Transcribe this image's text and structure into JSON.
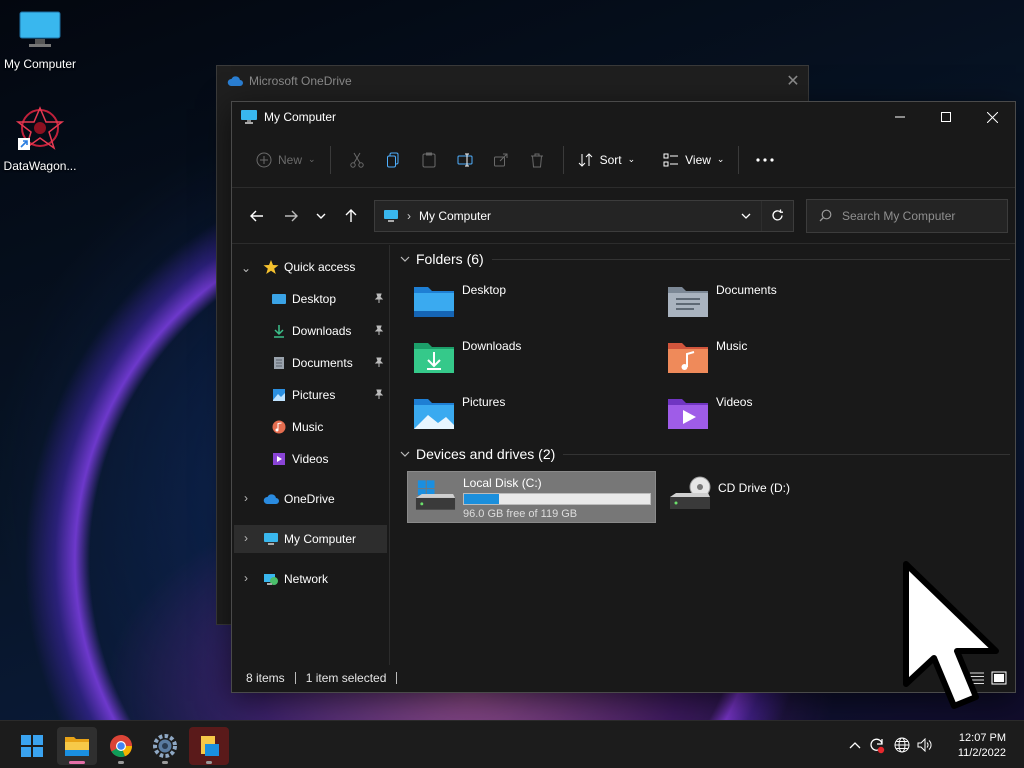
{
  "desktop": {
    "icons": [
      {
        "label": "My Computer"
      },
      {
        "label": "DataWagon..."
      }
    ]
  },
  "back_window": {
    "title": "Microsoft OneDrive"
  },
  "window": {
    "title": "My Computer",
    "toolbar": {
      "new_label": "New",
      "sort_label": "Sort",
      "view_label": "View"
    },
    "address": {
      "path": "My Computer"
    },
    "search": {
      "placeholder": "Search My Computer"
    },
    "nav": {
      "quick_access": "Quick access",
      "items": [
        {
          "label": "Desktop"
        },
        {
          "label": "Downloads"
        },
        {
          "label": "Documents"
        },
        {
          "label": "Pictures"
        },
        {
          "label": "Music"
        },
        {
          "label": "Videos"
        }
      ],
      "onedrive": "OneDrive",
      "my_computer": "My Computer",
      "network": "Network"
    },
    "folders_header": "Folders (6)",
    "folders": [
      {
        "label": "Desktop"
      },
      {
        "label": "Documents"
      },
      {
        "label": "Downloads"
      },
      {
        "label": "Music"
      },
      {
        "label": "Pictures"
      },
      {
        "label": "Videos"
      }
    ],
    "drives_header": "Devices and drives (2)",
    "drives": [
      {
        "label": "Local Disk (C:)",
        "free_text": "96.0 GB free of 119 GB",
        "used_fraction": 0.19
      },
      {
        "label": "CD Drive (D:)"
      }
    ],
    "status": {
      "items": "8 items",
      "selected": "1 item selected"
    }
  },
  "taskbar": {
    "apps": [
      "start-icon",
      "file-explorer-icon",
      "chrome-icon",
      "settings-icon",
      "app-icon"
    ],
    "time": "12:07 PM",
    "date": "11/2/2022"
  },
  "colors": {
    "accent": "#1b8fdc",
    "window_bg": "#191919",
    "taskbar_bg": "#1c1c1c"
  }
}
